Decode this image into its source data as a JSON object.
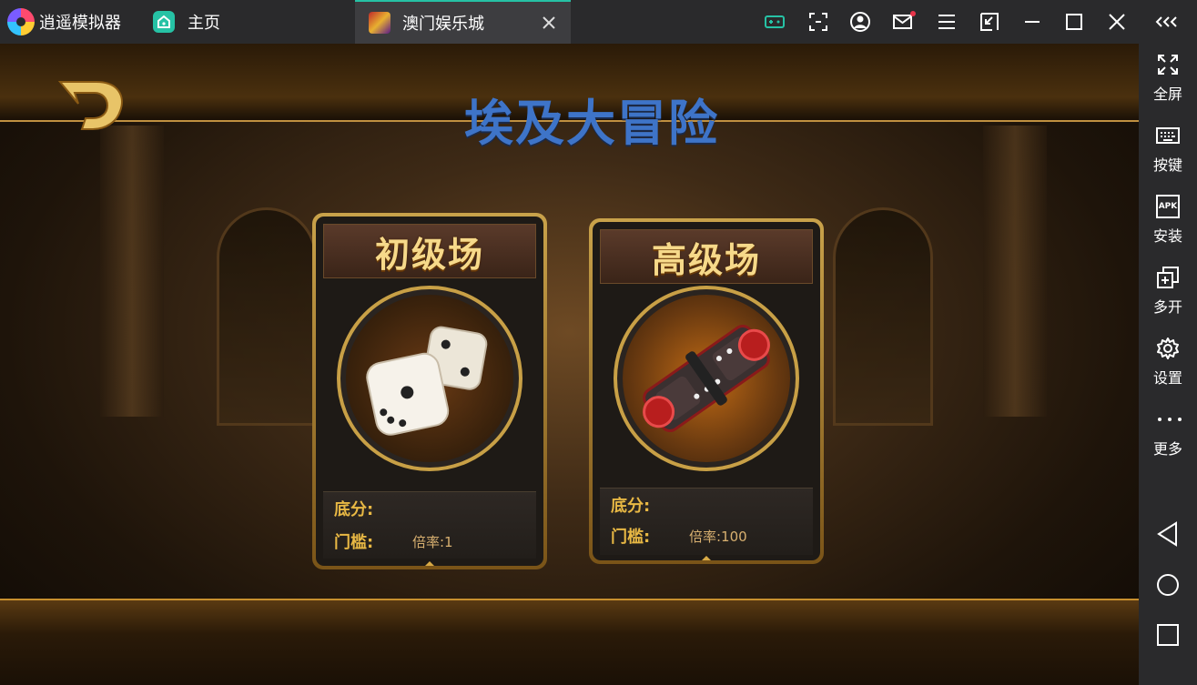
{
  "titlebar": {
    "brand_name": "逍遥模拟器",
    "home_tab": "主页",
    "game_tab": "澳门娱乐城"
  },
  "game": {
    "title": "埃及大冒险",
    "rooms": [
      {
        "name": "初级场",
        "base_label": "底分:",
        "base_value": "",
        "threshold_label": "门槛:",
        "threshold_value": "倍率:1",
        "icon": "white-dice-icon"
      },
      {
        "name": "高级场",
        "base_label": "底分:",
        "base_value": "",
        "threshold_label": "门槛:",
        "threshold_value": "倍率:100",
        "icon": "red-dice-icon"
      }
    ]
  },
  "sidebar": {
    "items": [
      {
        "label": "全屏",
        "icon": "fullscreen-icon"
      },
      {
        "label": "按键",
        "icon": "keyboard-icon"
      },
      {
        "label": "安装",
        "icon": "apk-install-icon"
      },
      {
        "label": "多开",
        "icon": "multi-instance-icon"
      },
      {
        "label": "设置",
        "icon": "gear-icon"
      },
      {
        "label": "更多",
        "icon": "more-icon"
      }
    ],
    "apk_text": "APK"
  },
  "colors": {
    "accent": "#26c2a5",
    "title_blue": "#3e74c8",
    "gold": "#c8a046",
    "chrome": "#2a2a2c",
    "notification": "#e8344a"
  }
}
